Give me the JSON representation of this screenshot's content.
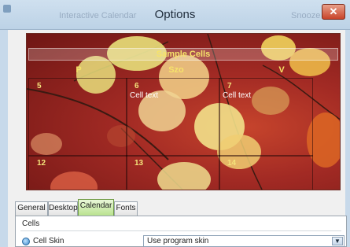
{
  "window": {
    "title": "Options",
    "ghost_left": "Interactive Calendar",
    "ghost_right": "Snooze",
    "close_label": "✕"
  },
  "preview": {
    "header": "Sample Cells",
    "day_names": [
      "P",
      "Szo",
      "V"
    ],
    "cells": [
      {
        "num": "5",
        "text": ""
      },
      {
        "num": "6",
        "text": "Cell text"
      },
      {
        "num": "7",
        "text": "Cell text"
      },
      {
        "num": "12",
        "text": ""
      },
      {
        "num": "13",
        "text": ""
      },
      {
        "num": "14",
        "text": ""
      }
    ]
  },
  "tabs": [
    {
      "label": "General",
      "active": false
    },
    {
      "label": "Desktop",
      "active": false
    },
    {
      "label": "Calendar",
      "active": true
    },
    {
      "label": "Fonts",
      "active": false
    }
  ],
  "panel": {
    "group_title": "Cells",
    "cell_skin_label": "Cell Skin",
    "cell_skin_value": "Use program skin",
    "dropdown_icon": "chevron-down-icon"
  }
}
